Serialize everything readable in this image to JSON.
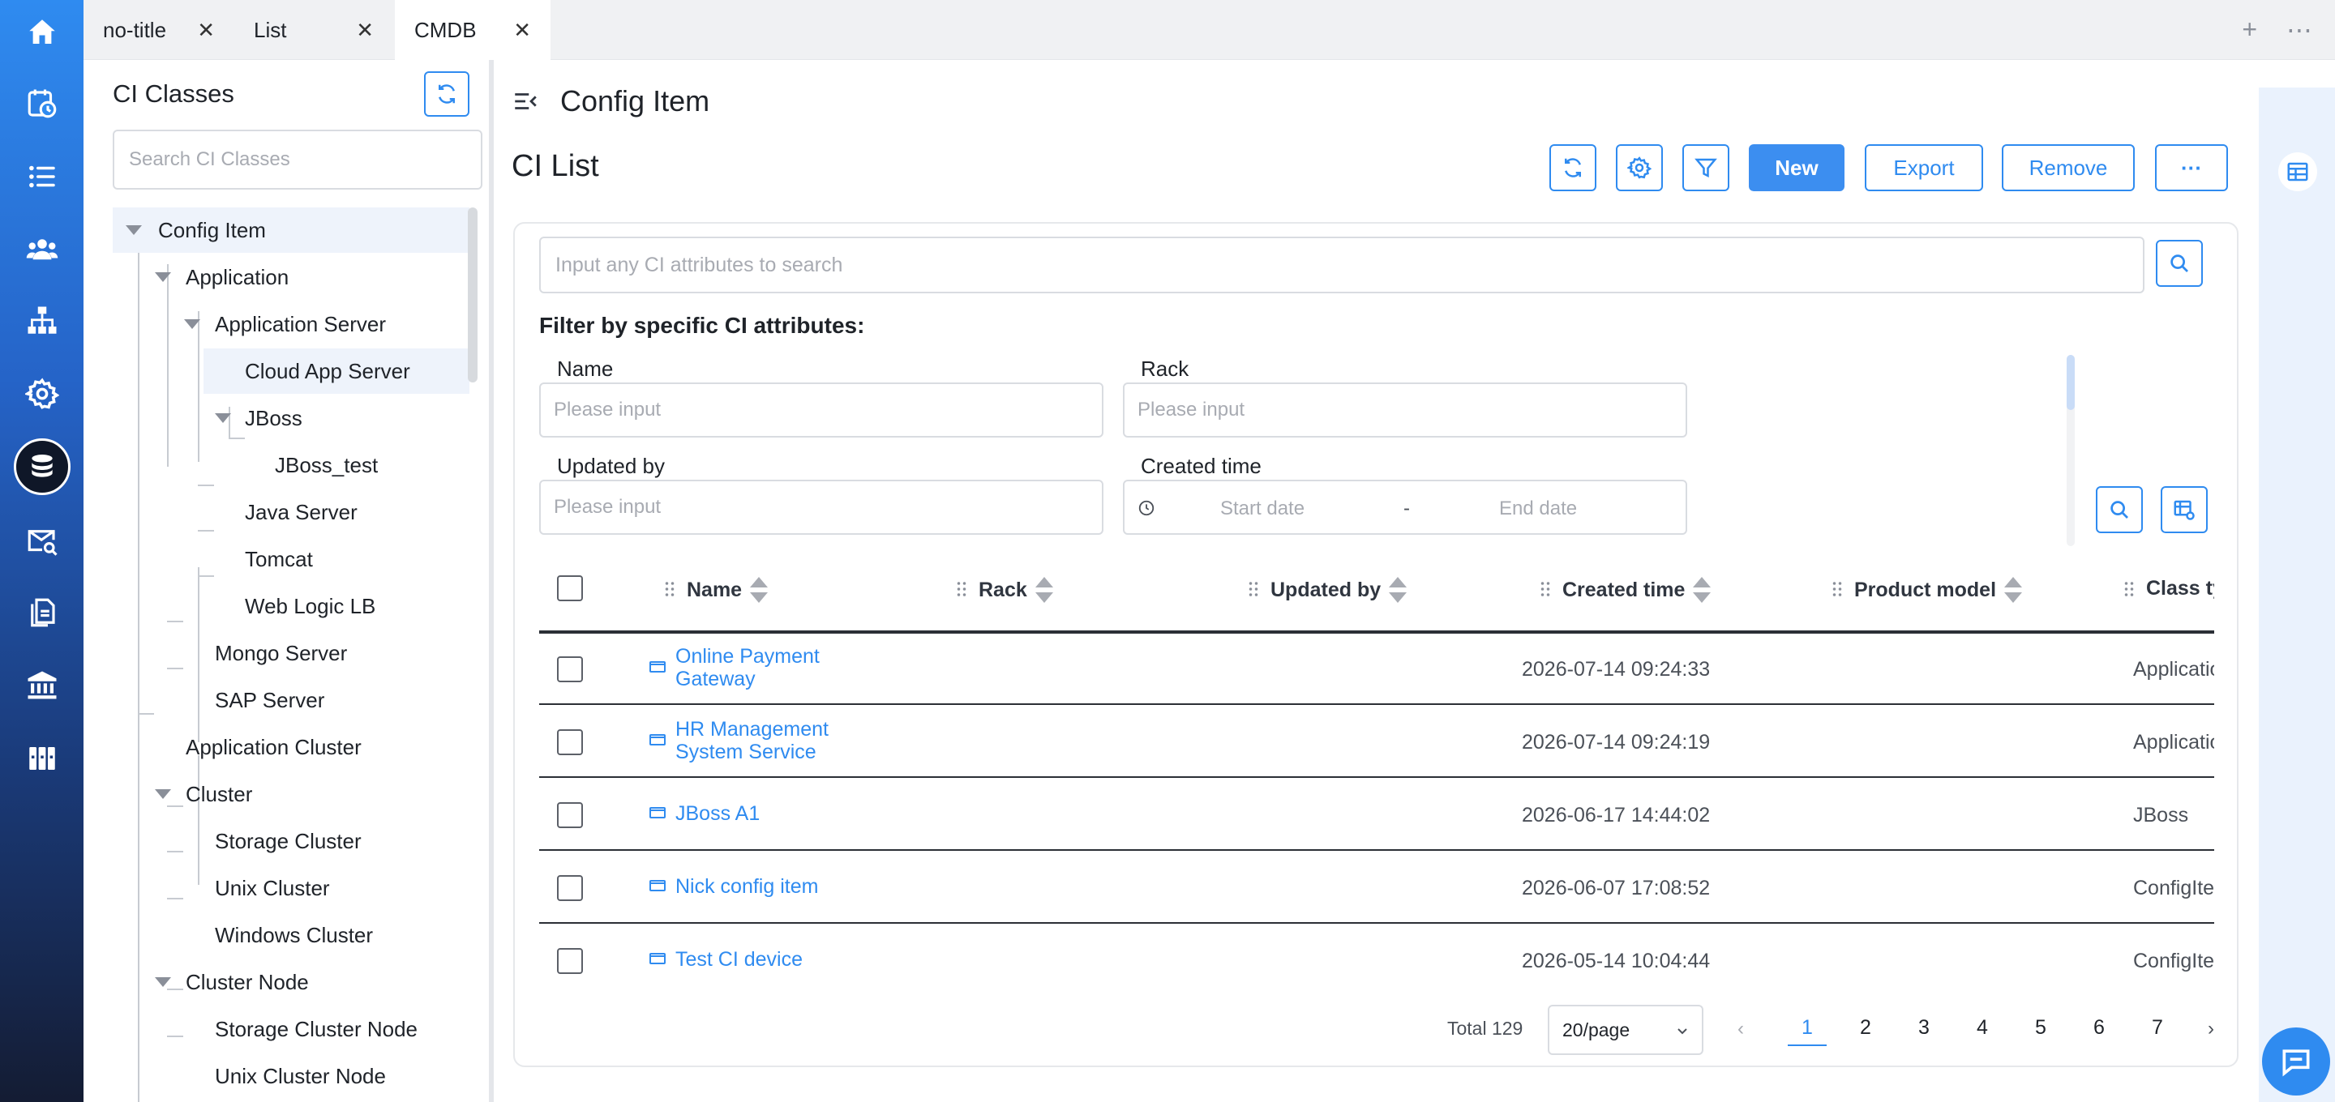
{
  "tabs": [
    {
      "label": "no-title"
    },
    {
      "label": "List"
    },
    {
      "label": "CMDB"
    }
  ],
  "tab_close": "✕",
  "tab_actions": {
    "add": "+",
    "more": "⋯"
  },
  "rail": {
    "items": [
      "home-icon",
      "dashboard-clock-icon",
      "list-icon",
      "users-icon",
      "org-tree-icon",
      "settings-icon",
      "database-icon",
      "mail-search-icon",
      "documents-icon",
      "bank-icon",
      "library-icon"
    ],
    "active": "database-icon"
  },
  "left_panel": {
    "title": "CI Classes",
    "search_placeholder": "Search CI Classes",
    "tree": [
      {
        "label": "Config Item"
      },
      {
        "label": "Application"
      },
      {
        "label": "Application Server"
      },
      {
        "label": "Cloud App Server"
      },
      {
        "label": "JBoss"
      },
      {
        "label": "JBoss_test"
      },
      {
        "label": "Java Server"
      },
      {
        "label": "Tomcat"
      },
      {
        "label": "Web Logic LB"
      },
      {
        "label": "Mongo Server"
      },
      {
        "label": "SAP Server"
      },
      {
        "label": "Application Cluster"
      },
      {
        "label": "Cluster"
      },
      {
        "label": "Storage Cluster"
      },
      {
        "label": "Unix Cluster"
      },
      {
        "label": "Windows Cluster"
      },
      {
        "label": "Cluster Node"
      },
      {
        "label": "Storage Cluster Node"
      },
      {
        "label": "Unix Cluster Node"
      }
    ]
  },
  "main": {
    "page_title": "Config Item",
    "list_title": "CI List",
    "buttons": {
      "new": "New",
      "export": "Export",
      "remove": "Remove",
      "more": "···"
    },
    "search_placeholder": "Input any CI attributes to search",
    "filter_heading": "Filter by specific CI attributes:",
    "filters": {
      "name": {
        "label": "Name",
        "placeholder": "Please input"
      },
      "rack": {
        "label": "Rack",
        "placeholder": "Please input"
      },
      "updated_by": {
        "label": "Updated by",
        "placeholder": "Please input"
      },
      "created_time": {
        "label": "Created time",
        "start": "Start date",
        "sep": "-",
        "end": "End date"
      }
    },
    "columns": [
      "Name",
      "Rack",
      "Updated by",
      "Created time",
      "Product model",
      "Class ty"
    ],
    "rows": [
      {
        "name": "Online Payment Gateway",
        "name_l1": "Online Payment",
        "name_l2": "Gateway",
        "created": "2026-07-14 09:24:33",
        "class_type": "Application"
      },
      {
        "name": "HR Management System Service",
        "name_l1": "HR Management",
        "name_l2": "System Service",
        "created": "2026-07-14 09:24:19",
        "class_type": "Application"
      },
      {
        "name": "JBoss A1",
        "name_l1": "JBoss A1",
        "name_l2": "",
        "created": "2026-06-17 14:44:02",
        "class_type": "JBoss"
      },
      {
        "name": "Nick config item",
        "name_l1": "Nick config item",
        "name_l2": "",
        "created": "2026-06-07 17:08:52",
        "class_type": "ConfigItem"
      },
      {
        "name": "Test CI device",
        "name_l1": "Test CI device",
        "name_l2": "",
        "created": "2026-05-14 10:04:44",
        "class_type": "ConfigItem"
      }
    ],
    "pagination": {
      "total": "Total 129",
      "per_page": "20/page",
      "prev": "‹",
      "next": "›",
      "pages": [
        "1",
        "2",
        "3",
        "4",
        "5",
        "6",
        "7"
      ],
      "current": "1"
    }
  },
  "colors": {
    "accent": "#2f8bf0",
    "primary_button": "#3c8ef0",
    "rail_top": "#2f8bf0",
    "rail_bottom": "#141c33"
  }
}
